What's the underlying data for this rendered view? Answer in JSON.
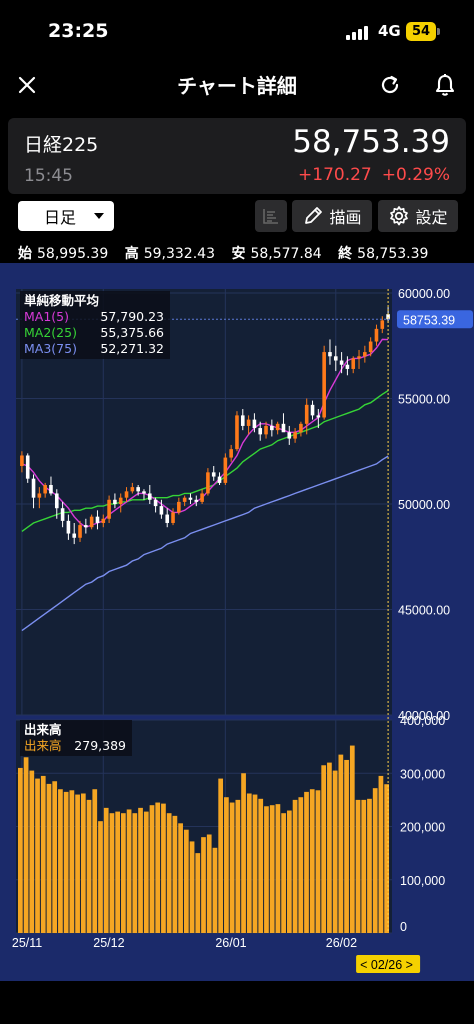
{
  "status": {
    "time": "23:25",
    "network": "4G",
    "battery": "54"
  },
  "header": {
    "title": "チャート詳細"
  },
  "quote": {
    "name": "日経225",
    "price": "58,753.39",
    "time": "15:45",
    "change": "+170.27",
    "change_pct": "+0.29%"
  },
  "toolbar": {
    "timeframe": "日足",
    "draw_label": "描画",
    "settings_label": "設定"
  },
  "ohlc": {
    "open_label": "始",
    "open": "58,995.39",
    "high_label": "高",
    "high": "59,332.43",
    "low_label": "安",
    "low": "58,577.84",
    "close_label": "終",
    "close": "58,753.39"
  },
  "legend": {
    "title": "単純移動平均",
    "items": [
      {
        "name": "MA1(5)",
        "value": "57,790.23",
        "color": "#d83ad8"
      },
      {
        "name": "MA2(25)",
        "value": "55,375.66",
        "color": "#36d436"
      },
      {
        "name": "MA3(75)",
        "value": "52,271.32",
        "color": "#7b8ff0"
      }
    ]
  },
  "volume_legend": {
    "title": "出来高",
    "name": "出来高",
    "value": "279,389",
    "color": "#f5a623"
  },
  "chart_data": {
    "type": "candlestick",
    "y_ticks": [
      "60000.00",
      "55000.00",
      "50000.00",
      "45000.00",
      "40000.00"
    ],
    "ylim": [
      40000,
      60000
    ],
    "last_price_label": "58753.39",
    "volume_ticks": [
      "400,000",
      "300,000",
      "200,000",
      "100,000",
      "0"
    ],
    "volume_ylim": [
      0,
      400000
    ],
    "x_labels": [
      "25/11",
      "25/12",
      "26/01",
      "26/02"
    ],
    "crosshair_label": "< 02/26 >",
    "up_color": "#ff7a1a",
    "down_color": "#ffffff",
    "candles": [
      [
        51800,
        52500,
        51500,
        52300
      ],
      [
        52300,
        52400,
        51000,
        51200
      ],
      [
        51200,
        51400,
        49800,
        50300
      ],
      [
        50300,
        50800,
        49800,
        50500
      ],
      [
        50500,
        51000,
        50300,
        50900
      ],
      [
        50900,
        51300,
        50400,
        50500
      ],
      [
        50500,
        50700,
        49300,
        49800
      ],
      [
        49800,
        50100,
        48900,
        49200
      ],
      [
        49200,
        49500,
        48300,
        48600
      ],
      [
        48600,
        49100,
        48100,
        48400
      ],
      [
        48400,
        49200,
        48200,
        49000
      ],
      [
        49000,
        49300,
        48600,
        48900
      ],
      [
        48900,
        49500,
        48800,
        49400
      ],
      [
        49400,
        49700,
        48800,
        49100
      ],
      [
        49100,
        49500,
        48900,
        49300
      ],
      [
        49300,
        50400,
        49100,
        50200
      ],
      [
        50200,
        50500,
        49800,
        50000
      ],
      [
        50000,
        50500,
        49600,
        50300
      ],
      [
        50300,
        50800,
        50100,
        50600
      ],
      [
        50600,
        51000,
        50500,
        50800
      ],
      [
        50800,
        50900,
        50400,
        50600
      ],
      [
        50600,
        50700,
        50200,
        50500
      ],
      [
        50500,
        50900,
        50000,
        50200
      ],
      [
        50200,
        50300,
        49600,
        49900
      ],
      [
        49900,
        50200,
        49300,
        49500
      ],
      [
        49500,
        49800,
        48900,
        49100
      ],
      [
        49100,
        49800,
        49000,
        49600
      ],
      [
        49600,
        50300,
        49500,
        50100
      ],
      [
        50100,
        50400,
        49900,
        50300
      ],
      [
        50300,
        50500,
        50000,
        50200
      ],
      [
        50200,
        50400,
        49900,
        50100
      ],
      [
        50100,
        50700,
        50000,
        50500
      ],
      [
        50500,
        51700,
        50400,
        51500
      ],
      [
        51500,
        51800,
        51100,
        51300
      ],
      [
        51300,
        51500,
        50900,
        51000
      ],
      [
        51000,
        52400,
        50900,
        52200
      ],
      [
        52200,
        52800,
        52000,
        52600
      ],
      [
        52600,
        54400,
        52500,
        54200
      ],
      [
        54200,
        54500,
        53500,
        53700
      ],
      [
        53700,
        54200,
        53300,
        54000
      ],
      [
        54000,
        54300,
        53400,
        53600
      ],
      [
        53600,
        53900,
        53000,
        53300
      ],
      [
        53300,
        53900,
        53100,
        53700
      ],
      [
        53700,
        54000,
        53200,
        53500
      ],
      [
        53500,
        53900,
        53300,
        53800
      ],
      [
        53800,
        54300,
        53500,
        53400
      ],
      [
        53400,
        53700,
        52800,
        53100
      ],
      [
        53100,
        53600,
        52900,
        53400
      ],
      [
        53400,
        53900,
        53200,
        53800
      ],
      [
        53800,
        55000,
        53300,
        54700
      ],
      [
        54700,
        54900,
        54000,
        54200
      ],
      [
        54200,
        54500,
        53600,
        54100
      ],
      [
        54100,
        57500,
        54000,
        57200
      ],
      [
        57200,
        57800,
        56600,
        57000
      ],
      [
        57000,
        57500,
        56300,
        56800
      ],
      [
        56800,
        57200,
        56200,
        56600
      ],
      [
        56600,
        57000,
        56100,
        56400
      ],
      [
        56400,
        57000,
        56200,
        56900
      ],
      [
        56900,
        57300,
        56400,
        57000
      ],
      [
        57000,
        57500,
        56700,
        57200
      ],
      [
        57200,
        57900,
        57000,
        57700
      ],
      [
        57700,
        58500,
        57500,
        58300
      ],
      [
        58300,
        58900,
        58100,
        58700
      ],
      [
        58995.39,
        59332.43,
        58577.84,
        58753.39
      ]
    ],
    "ma1": [
      51900,
      51800,
      51500,
      51100,
      50800,
      50600,
      50400,
      50100,
      49800,
      49400,
      49100,
      48900,
      49000,
      49100,
      49200,
      49500,
      49700,
      49900,
      50100,
      50300,
      50500,
      50500,
      50400,
      50200,
      50000,
      49800,
      49600,
      49600,
      49700,
      49900,
      50100,
      50300,
      50600,
      50900,
      51200,
      51500,
      51900,
      52300,
      52900,
      53300,
      53600,
      53800,
      53800,
      53700,
      53600,
      53500,
      53400,
      53400,
      53500,
      53700,
      53900,
      54100,
      54800,
      55400,
      55900,
      56400,
      56800,
      56900,
      56900,
      57000,
      57100,
      57400,
      57800,
      57790.23
    ],
    "ma2": [
      48700,
      48900,
      49100,
      49200,
      49300,
      49400,
      49500,
      49600,
      49600,
      49700,
      49700,
      49800,
      49800,
      49900,
      49900,
      50000,
      50000,
      50100,
      50100,
      50200,
      50200,
      50200,
      50300,
      50300,
      50300,
      50300,
      50400,
      50400,
      50500,
      50500,
      50600,
      50700,
      50800,
      50900,
      51100,
      51300,
      51500,
      51700,
      52000,
      52200,
      52400,
      52600,
      52700,
      52800,
      53000,
      53100,
      53200,
      53300,
      53400,
      53500,
      53600,
      53700,
      53900,
      54000,
      54100,
      54200,
      54300,
      54400,
      54500,
      54700,
      54800,
      55000,
      55200,
      55375.66
    ],
    "ma3": [
      44000,
      44200,
      44400,
      44600,
      44800,
      45000,
      45200,
      45400,
      45600,
      45800,
      46000,
      46200,
      46300,
      46500,
      46600,
      46800,
      46900,
      47000,
      47100,
      47300,
      47400,
      47600,
      47700,
      47800,
      47900,
      48100,
      48200,
      48300,
      48400,
      48600,
      48700,
      48800,
      48900,
      49000,
      49100,
      49200,
      49300,
      49400,
      49500,
      49600,
      49800,
      49900,
      50000,
      50100,
      50200,
      50300,
      50400,
      50500,
      50600,
      50700,
      50800,
      50900,
      51000,
      51100,
      51200,
      51300,
      51400,
      51500,
      51600,
      51700,
      51800,
      51900,
      52100,
      52271.32
    ],
    "volumes": [
      310000,
      330000,
      305000,
      290000,
      295000,
      280000,
      285000,
      270000,
      265000,
      268000,
      260000,
      262000,
      250000,
      270000,
      210000,
      235000,
      225000,
      228000,
      225000,
      232000,
      225000,
      235000,
      228000,
      240000,
      245000,
      243000,
      225000,
      220000,
      206000,
      194000,
      172000,
      150000,
      180000,
      185000,
      160000,
      290000,
      255000,
      245000,
      250000,
      300000,
      262000,
      260000,
      252000,
      238000,
      240000,
      242000,
      225000,
      230000,
      250000,
      255000,
      265000,
      270000,
      268000,
      315000,
      320000,
      305000,
      335000,
      325000,
      352000,
      250000,
      250000,
      252000,
      272000,
      295000,
      279389
    ]
  }
}
